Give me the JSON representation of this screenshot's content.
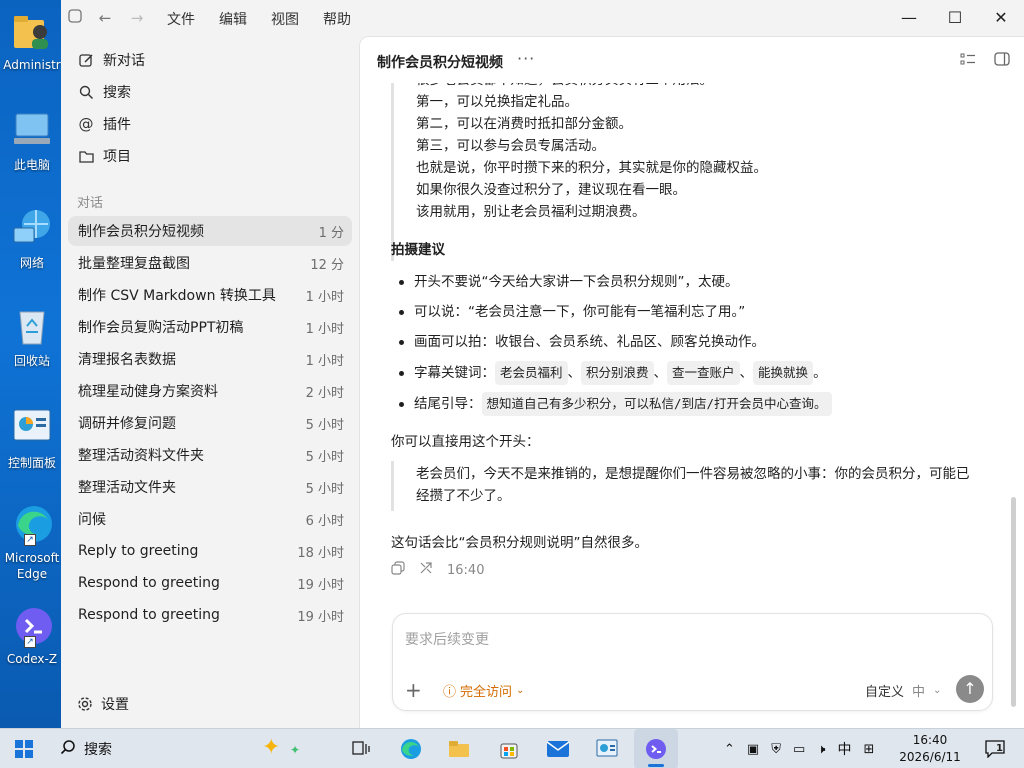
{
  "desktop": {
    "icons": [
      {
        "label": "Administr",
        "icon": "user-folder-icon"
      },
      {
        "label": "此电脑",
        "icon": "computer-icon"
      },
      {
        "label": "网络",
        "icon": "network-icon"
      },
      {
        "label": "回收站",
        "icon": "recycle-bin-icon"
      },
      {
        "label": "控制面板",
        "icon": "control-panel-icon"
      },
      {
        "label": "Microsoft Edge",
        "icon": "edge-icon"
      },
      {
        "label": "Codex-Z",
        "icon": "codex-icon"
      }
    ]
  },
  "titlebar": {
    "menus": [
      "文件",
      "编辑",
      "视图",
      "帮助"
    ]
  },
  "sidebar": {
    "nav": [
      {
        "label": "新对话",
        "icon": "edit-icon"
      },
      {
        "label": "搜索",
        "icon": "search-icon"
      },
      {
        "label": "插件",
        "icon": "at-icon"
      },
      {
        "label": "项目",
        "icon": "folder-icon"
      }
    ],
    "section_label": "对话",
    "conversations": [
      {
        "title": "制作会员积分短视频",
        "time": "1 分"
      },
      {
        "title": "批量整理复盘截图",
        "time": "12 分"
      },
      {
        "title": "制作 CSV Markdown 转换工具",
        "time": "1 小时"
      },
      {
        "title": "制作会员复购活动PPT初稿",
        "time": "1 小时"
      },
      {
        "title": "清理报名表数据",
        "time": "1 小时"
      },
      {
        "title": "梳理星动健身方案资料",
        "time": "2 小时"
      },
      {
        "title": "调研并修复问题",
        "time": "5 小时"
      },
      {
        "title": "整理活动资料文件夹",
        "time": "5 小时"
      },
      {
        "title": "整理活动文件夹",
        "time": "5 小时"
      },
      {
        "title": "问候",
        "time": "6 小时"
      },
      {
        "title": "Reply to greeting",
        "time": "18 小时"
      },
      {
        "title": "Respond to greeting",
        "time": "19 小时"
      },
      {
        "title": "Respond to greeting",
        "time": "19 小时"
      }
    ],
    "settings_label": "设置"
  },
  "main": {
    "title": "制作会员积分短视频",
    "more": "···",
    "quote_lines": [
      "很多老会员都不知道，会员积分其实有三个用法。",
      "第一，可以兑换指定礼品。",
      "第二，可以在消费时抵扣部分金额。",
      "第三，可以参与会员专属活动。",
      "也就是说，你平时攒下来的积分，其实就是你的隐藏权益。",
      "如果你很久没查过积分了，建议现在看一眼。",
      "该用就用，别让老会员福利过期浪费。"
    ],
    "tips_heading": "拍摄建议",
    "tips": {
      "t1": "开头不要说“今天给大家讲一下会员积分规则”，太硬。",
      "t2": "可以说：“老会员注意一下，你可能有一笔福利忘了用。”",
      "t3": "画面可以拍：收银台、会员系统、礼品区、顾客兑换动作。",
      "t4_prefix": "字幕关键词：",
      "t4_codes": [
        "老会员福利",
        "积分别浪费",
        "查一查账户",
        "能换就换"
      ],
      "t4_sep": "、",
      "t4_end": "。",
      "t5_prefix": "结尾引导：",
      "t5_code": "想知道自己有多少积分，可以私信/到店/打开会员中心查询。"
    },
    "intro": "你可以直接用这个开头：",
    "opening_quote_l1": "老会员们，今天不是来推销的，是想提醒你们一件容易被忽略的小事：你的会员积分，可能已",
    "opening_quote_l2": "经攒了不少了。",
    "closing": "这句话会比“会员积分规则说明”自然很多。",
    "timestamp": "16:40"
  },
  "composer": {
    "placeholder": "要求后续变更",
    "access_label": "完全访问",
    "model_label": "自定义",
    "level_label": "中"
  },
  "taskbar": {
    "search_label": "搜索",
    "ime": "中",
    "time": "16:40",
    "date": "2026/6/11",
    "notifications": "1"
  }
}
